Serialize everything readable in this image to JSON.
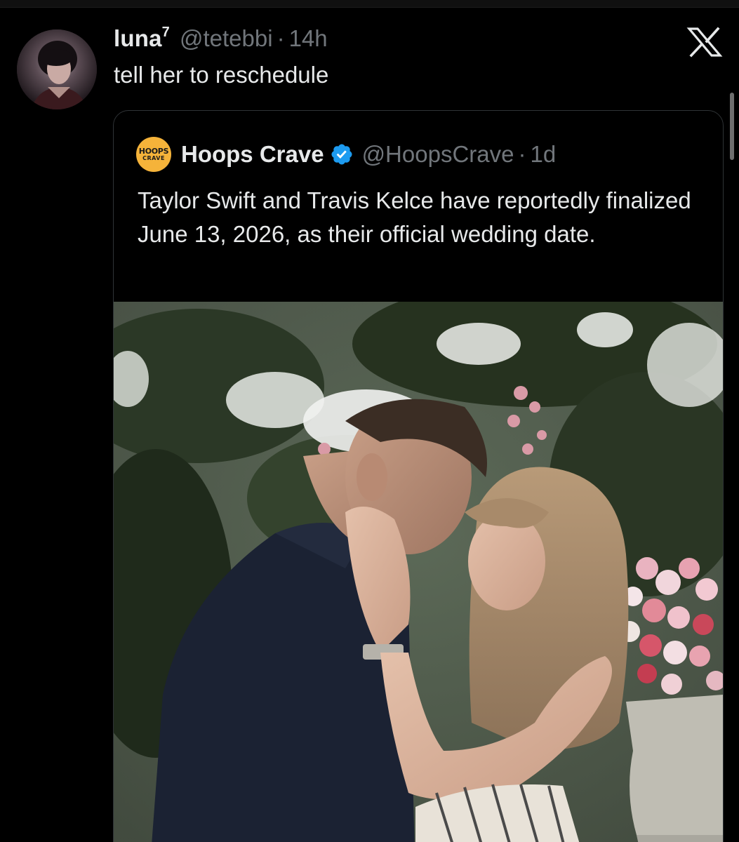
{
  "reply": {
    "display_name": "luna",
    "name_superscript": "7",
    "handle": "@tetebbi",
    "separator": "·",
    "time": "14h",
    "text": "tell her to reschedule"
  },
  "quoted_post": {
    "avatar_text_line1": "HOOPS",
    "avatar_text_line2": "CRAVE",
    "display_name": "Hoops Crave",
    "verified": true,
    "handle": "@HoopsCrave",
    "separator": "·",
    "time": "1d",
    "text": "Taylor Swift and Travis Kelce have reportedly finalized June 13, 2026, as their official wedding date."
  },
  "icons": {
    "close": "x-logo-icon",
    "verified": "verified-badge-icon"
  },
  "colors": {
    "background": "#000000",
    "text_primary": "#e7e9ea",
    "text_secondary": "#71767b",
    "border": "#2f3336",
    "verified_blue": "#1d9bf0",
    "hoops_avatar": "#f5b33a"
  }
}
